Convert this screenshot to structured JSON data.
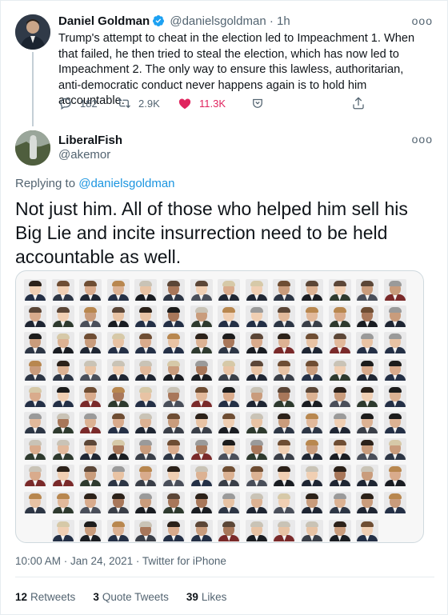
{
  "parent": {
    "name": "Daniel Goldman",
    "handle": "@danielsgoldman",
    "separator": "·",
    "time": "1h",
    "more": "ooo",
    "text": "Trump's attempt to cheat in the election led to Impeachment 1. When that failed, he then tried to steal the election, which has now led to Impeachment 2. The only way to ensure this lawless, authoritarian, anti-democratic conduct never happens again is to hold him accountable.",
    "actions": {
      "reply_count": "182",
      "retweet_count": "2.9K",
      "like_count": "11.3K"
    },
    "icons": [
      "verified-icon",
      "reply-icon",
      "retweet-icon",
      "heart-icon",
      "share-icon",
      "upload-icon"
    ]
  },
  "reply": {
    "name": "LiberalFish",
    "handle": "@akemor",
    "more": "ooo",
    "replying_prefix": "Replying to",
    "replying_to": "@danielsgoldman",
    "text": "Not just him. All of those who helped him sell his Big Lie and incite insurrection need to be held accountable as well.",
    "timestamp": "10:00 AM · Jan 24, 2021 · Twitter for iPhone",
    "stats": {
      "retweets_count": "12",
      "retweets_label": "Retweets",
      "quotes_count": "3",
      "quotes_label": "Quote Tweets",
      "likes_count": "39",
      "likes_label": "Likes"
    }
  },
  "colors": {
    "link": "#1b95e0",
    "liked": "#e0245e",
    "muted": "#536471",
    "verified": "#1da1f2"
  },
  "image": {
    "rows_full": 9,
    "cols_full": 14,
    "last_row_count": 12
  }
}
